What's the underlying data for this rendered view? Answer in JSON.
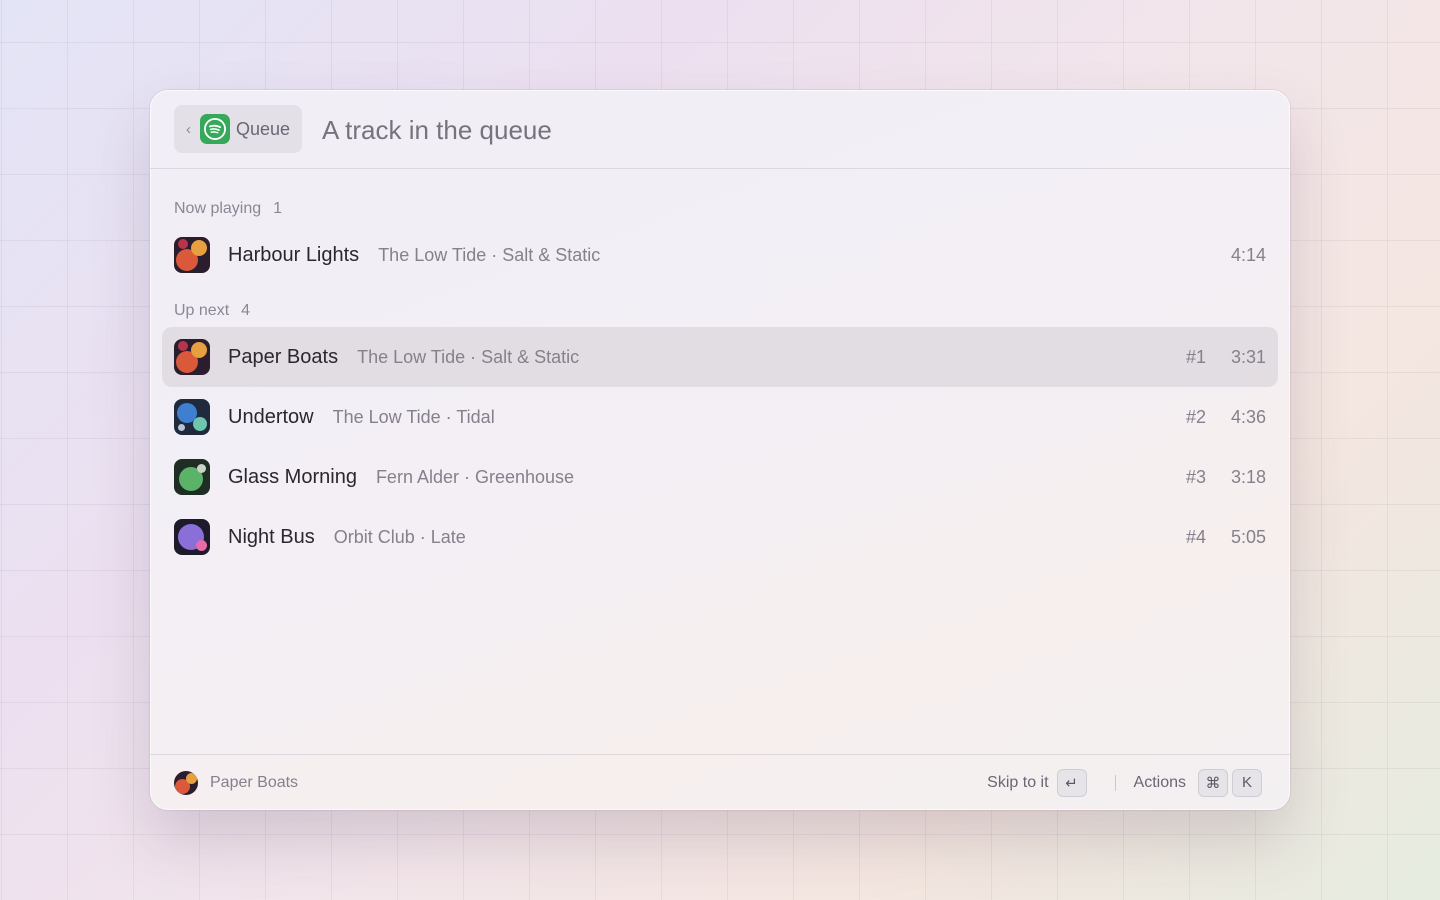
{
  "header": {
    "back_chip_label": "Queue",
    "search_value": "",
    "search_placeholder": "A track in the queue"
  },
  "sections": {
    "now_playing": {
      "label": "Now playing",
      "count": "1"
    },
    "up_next": {
      "label": "Up next",
      "count": "4"
    }
  },
  "now_playing": {
    "title": "Harbour Lights",
    "subtitle": "The Low Tide · Salt & Static",
    "duration": "4:14"
  },
  "up_next": [
    {
      "title": "Paper Boats",
      "subtitle": "The Low Tide · Salt & Static",
      "rank": "#1",
      "duration": "3:31",
      "selected": true
    },
    {
      "title": "Undertow",
      "subtitle": "The Low Tide · Tidal",
      "rank": "#2",
      "duration": "4:36",
      "selected": false
    },
    {
      "title": "Glass Morning",
      "subtitle": "Fern Alder · Greenhouse",
      "rank": "#3",
      "duration": "3:18",
      "selected": false
    },
    {
      "title": "Night Bus",
      "subtitle": "Orbit Club · Late",
      "rank": "#4",
      "duration": "5:05",
      "selected": false
    }
  ],
  "footer": {
    "current_title": "Paper Boats",
    "primary_action_label": "Skip to it",
    "primary_action_key": "↵",
    "actions_label": "Actions",
    "actions_keys": [
      "⌘",
      "K"
    ]
  },
  "colors": {
    "app_icon_green": "#35a85a",
    "selected_row": "#dcd7dc"
  }
}
